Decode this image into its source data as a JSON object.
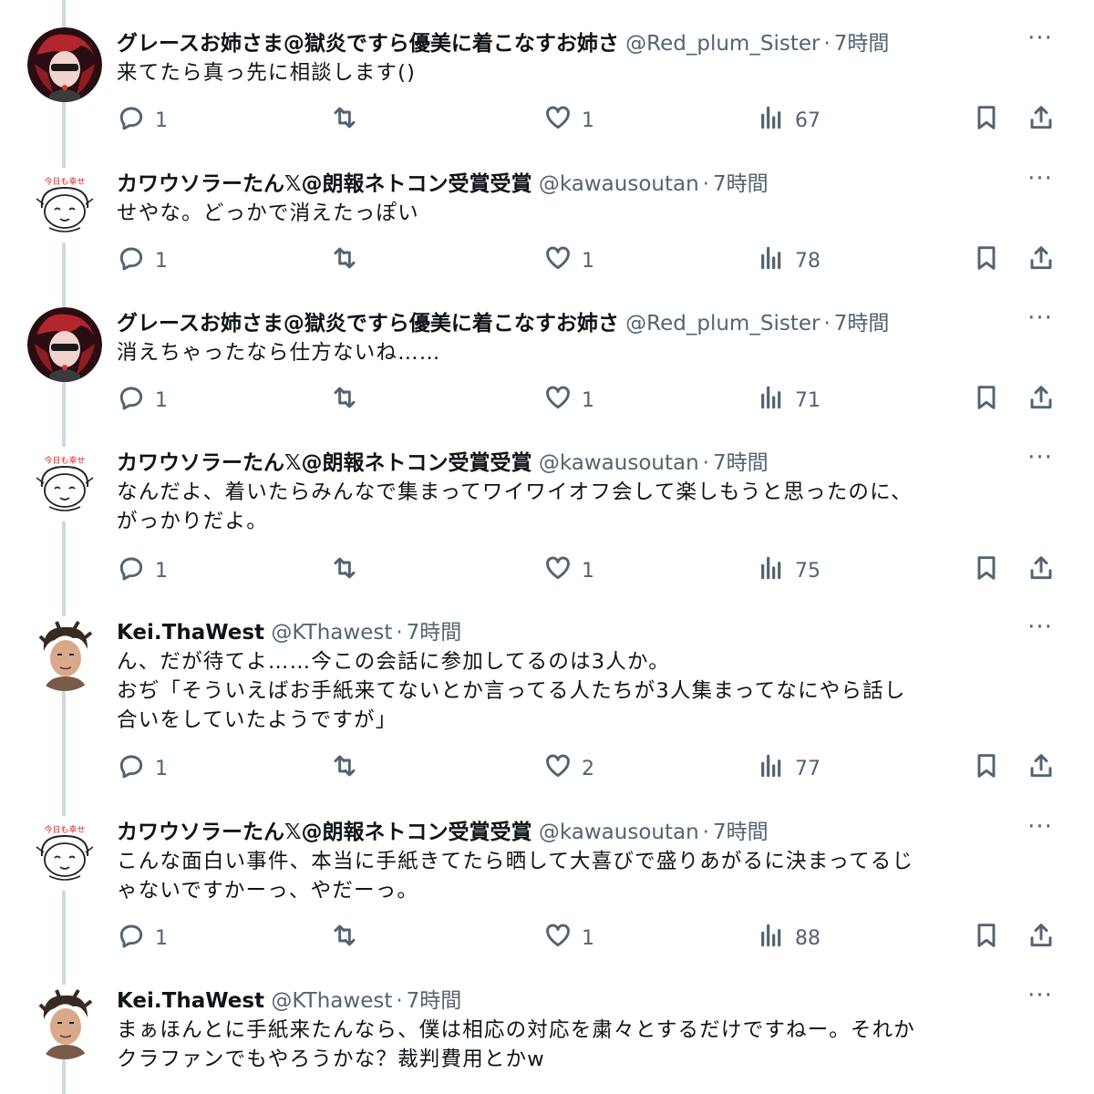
{
  "tweets": [
    {
      "name": "グレースお姉さま@獄炎ですら優美に着こなすお姉さ",
      "handle": "@Red_plum_Sister",
      "time": "7時間",
      "text": "来てたら真っ先に相談します()",
      "avatar": "grace-avatar",
      "replies": "1",
      "likes": "1",
      "views": "67"
    },
    {
      "name": "カワウソラーたん𝕏@朗報ネトコン受賞受賞",
      "handle": "@kawausoutan",
      "time": "7時間",
      "text": "せやな。どっかで消えたっぽい",
      "avatar": "kawauso-avatar",
      "replies": "1",
      "likes": "1",
      "views": "78"
    },
    {
      "name": "グレースお姉さま@獄炎ですら優美に着こなすお姉さ",
      "handle": "@Red_plum_Sister",
      "time": "7時間",
      "text": "消えちゃったなら仕方ないね……",
      "avatar": "grace-avatar",
      "replies": "1",
      "likes": "1",
      "views": "71"
    },
    {
      "name": "カワウソラーたん𝕏@朗報ネトコン受賞受賞",
      "handle": "@kawausoutan",
      "time": "7時間",
      "text": "なんだよ、着いたらみんなで集まってワイワイオフ会して楽しもうと思ったのに、\nがっかりだよ。",
      "avatar": "kawauso-avatar",
      "replies": "1",
      "likes": "1",
      "views": "75"
    },
    {
      "name": "Kei.ThaWest",
      "handle": "@KThawest",
      "time": "7時間",
      "text": "ん、だが待てよ……今この会話に参加してるのは3人か。\nおぢ「そういえばお手紙来てないとか言ってる人たちが3人集まってなにやら話し\n合いをしていたようですが」",
      "avatar": "kei-avatar",
      "replies": "1",
      "likes": "2",
      "views": "77"
    },
    {
      "name": "カワウソラーたん𝕏@朗報ネトコン受賞受賞",
      "handle": "@kawausoutan",
      "time": "7時間",
      "text": "こんな面白い事件、本当に手紙きてたら晒して大喜びで盛りあがるに決まってるじ\nゃないですかーっ、やだーっ。",
      "avatar": "kawauso-avatar",
      "replies": "1",
      "likes": "1",
      "views": "88"
    },
    {
      "name": "Kei.ThaWest",
      "handle": "@KThawest",
      "time": "7時間",
      "text": "まぁほんとに手紙来たんなら、僕は相応の対応を粛々とするだけですねー。それか\nクラファンでもやろうかな？裁判費用とかw",
      "avatar": "kei-avatar"
    }
  ],
  "separator": "·",
  "more_label": "···",
  "colors": {
    "text": "#0f1419",
    "muted": "#536471",
    "thread": "#cfd9de"
  }
}
